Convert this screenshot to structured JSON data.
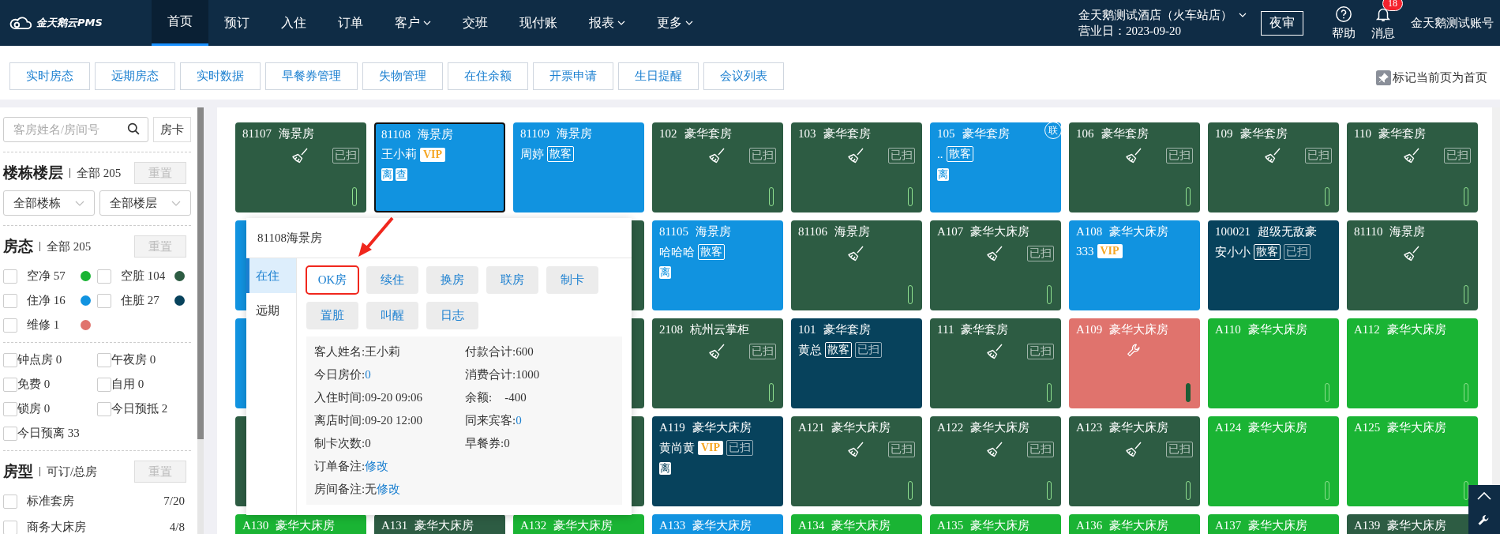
{
  "header": {
    "logo": "金天鹅云PMS",
    "nav": [
      {
        "label": "首页",
        "selected": true,
        "dropdown": false
      },
      {
        "label": "预订",
        "selected": false,
        "dropdown": false
      },
      {
        "label": "入住",
        "selected": false,
        "dropdown": false
      },
      {
        "label": "订单",
        "selected": false,
        "dropdown": false
      },
      {
        "label": "客户",
        "selected": false,
        "dropdown": true
      },
      {
        "label": "交班",
        "selected": false,
        "dropdown": false
      },
      {
        "label": "现付账",
        "selected": false,
        "dropdown": false
      },
      {
        "label": "报表",
        "selected": false,
        "dropdown": true
      },
      {
        "label": "更多",
        "selected": false,
        "dropdown": true
      }
    ],
    "hotel": "金天鹅测试酒店（火车站店）",
    "business_day": "营业日：2023-09-20",
    "night_audit": "夜审",
    "help": "帮助",
    "messages": {
      "label": "消息",
      "badge": "18"
    },
    "account": "金天鹅测试账号"
  },
  "tabs": [
    {
      "label": "实时房态",
      "selected": false
    },
    {
      "label": "远期房态",
      "selected": false
    },
    {
      "label": "实时数据",
      "selected": false
    },
    {
      "label": "早餐券管理",
      "selected": false
    },
    {
      "label": "失物管理",
      "selected": false
    },
    {
      "label": "在住余额",
      "selected": false
    },
    {
      "label": "开票申请",
      "selected": false
    },
    {
      "label": "生日提醒",
      "selected": false
    },
    {
      "label": "会议列表",
      "selected": false
    }
  ],
  "pin_home": "标记当前页为首页",
  "sidebar": {
    "search": {
      "placeholder": "客房姓名/房间号"
    },
    "card_button": "房卡",
    "building": {
      "title": "楼栋楼层",
      "summary": "全部 205",
      "reset": {
        "label": "重置",
        "disabled": true
      },
      "selects": [
        "全部楼栋",
        "全部楼层"
      ]
    },
    "status": {
      "title": "房态",
      "summary": "全部 205",
      "reset": {
        "label": "重置",
        "disabled": true
      },
      "filters": [
        {
          "label": "空净 57",
          "checked": false,
          "color": "#1ab434"
        },
        {
          "label": "空脏 104",
          "checked": false,
          "color": "#2d5c43"
        },
        {
          "label": "住净 16",
          "checked": false,
          "color": "#1193e0"
        },
        {
          "label": "住脏 27",
          "checked": false,
          "color": "#07425c"
        },
        {
          "label": "维修 1",
          "checked": false,
          "color": "#e0736d"
        }
      ]
    },
    "flags": [
      {
        "label": "钟点房 0",
        "checked": false
      },
      {
        "label": "午夜房 0",
        "checked": false
      },
      {
        "label": "免费 0",
        "checked": false
      },
      {
        "label": "自用 0",
        "checked": false
      },
      {
        "label": "锁房 0",
        "checked": false
      },
      {
        "label": "今日预抵 2",
        "checked": false
      },
      {
        "label": "今日预离 33",
        "checked": false
      }
    ],
    "room_types": {
      "title": "房型",
      "summary": "可订/总房",
      "reset": {
        "label": "重置",
        "disabled": true
      },
      "items": [
        {
          "label": "标准套房",
          "count": "7/20",
          "checked": false
        },
        {
          "label": "商务大床房",
          "count": "4/8",
          "checked": false
        }
      ]
    }
  },
  "grid": {
    "rows": [
      [
        {
          "kind": "vacant_dirty",
          "number": "81107",
          "type": "海景房",
          "selected": false,
          "tags": [
            {
              "kind": "swept",
              "text": "已扫"
            }
          ]
        },
        {
          "kind": "occupied_clean",
          "number": "81108",
          "type": "海景房",
          "selected": true,
          "guest": "王小莉",
          "tags": [
            {
              "kind": "vip",
              "text": "VIP"
            }
          ],
          "marks": [
            "离",
            "查"
          ]
        },
        {
          "kind": "occupied_clean",
          "number": "81109",
          "type": "海景房",
          "selected": false,
          "guest": "周婷",
          "tags": [
            {
              "kind": "walkin",
              "text": "散客"
            }
          ]
        },
        {
          "kind": "vacant_dirty",
          "number": "102",
          "type": "豪华套房",
          "selected": false,
          "tags": [
            {
              "kind": "swept",
              "text": "已扫"
            }
          ]
        },
        {
          "kind": "vacant_dirty",
          "number": "103",
          "type": "豪华套房",
          "selected": false,
          "tags": [
            {
              "kind": "swept",
              "text": "已扫"
            }
          ]
        },
        {
          "kind": "occupied_clean",
          "number": "105",
          "type": "豪华套房",
          "selected": false,
          "guest": "..",
          "tags": [
            {
              "kind": "walkin",
              "text": "散客"
            }
          ],
          "marks": [
            "离"
          ],
          "linked": "联"
        },
        {
          "kind": "vacant_dirty",
          "number": "106",
          "type": "豪华套房",
          "selected": false,
          "tags": [
            {
              "kind": "swept",
              "text": "已扫"
            }
          ]
        },
        {
          "kind": "vacant_dirty",
          "number": "109",
          "type": "豪华套房",
          "selected": false,
          "tags": [
            {
              "kind": "swept",
              "text": "已扫"
            }
          ]
        },
        {
          "kind": "vacant_dirty",
          "number": "110",
          "type": "豪华套房",
          "selected": false,
          "tags": [
            {
              "kind": "swept",
              "text": "已扫"
            }
          ]
        }
      ],
      [
        {
          "kind": "covered",
          "color": "#1193e0"
        },
        {
          "kind": "covered"
        },
        {
          "kind": "covered",
          "color": "#2d5c43"
        },
        {
          "kind": "occupied_clean",
          "number": "81105",
          "type": "海景房",
          "selected": false,
          "guest": "哈哈哈",
          "tags": [
            {
              "kind": "walkin",
              "text": "散客"
            }
          ],
          "marks": [
            "离"
          ]
        },
        {
          "kind": "vacant_dirty",
          "number": "81106",
          "type": "海景房",
          "selected": false
        },
        {
          "kind": "vacant_dirty",
          "number": "A107",
          "type": "豪华大床房",
          "selected": false,
          "tags": [
            {
              "kind": "swept",
              "text": "已扫"
            }
          ]
        },
        {
          "kind": "occupied_clean",
          "number": "A108",
          "type": "豪华大床房",
          "selected": false,
          "guest": "333",
          "tags": [
            {
              "kind": "vip",
              "text": "VIP"
            }
          ]
        },
        {
          "kind": "occupied_dirty",
          "number": "100021",
          "type": "超级无敌豪",
          "selected": false,
          "guest": "安小小",
          "tags": [
            {
              "kind": "walkin",
              "text": "散客"
            },
            {
              "kind": "swept",
              "text": "已扫"
            }
          ]
        },
        {
          "kind": "vacant_dirty",
          "number": "81110",
          "type": "海景房",
          "selected": false
        }
      ],
      [
        {
          "kind": "covered",
          "color": "#1193e0"
        },
        {
          "kind": "covered"
        },
        {
          "kind": "covered",
          "color": "#2d5c43"
        },
        {
          "kind": "vacant_dirty",
          "number": "2108",
          "type": "杭州云掌柜",
          "selected": false,
          "tags": [
            {
              "kind": "swept",
              "text": "已扫"
            }
          ]
        },
        {
          "kind": "occupied_dirty",
          "number": "101",
          "type": "豪华套房",
          "selected": false,
          "guest": "黄总",
          "tags": [
            {
              "kind": "walkin",
              "text": "散客"
            },
            {
              "kind": "swept",
              "text": "已扫"
            }
          ]
        },
        {
          "kind": "vacant_dirty",
          "number": "111",
          "type": "豪华套房",
          "selected": false,
          "tags": [
            {
              "kind": "swept",
              "text": "已扫"
            }
          ]
        },
        {
          "kind": "maintenance",
          "number": "A109",
          "type": "豪华大床房",
          "selected": false
        },
        {
          "kind": "vacant_clean",
          "number": "A110",
          "type": "豪华大床房",
          "selected": false
        },
        {
          "kind": "vacant_clean",
          "number": "A112",
          "type": "豪华大床房",
          "selected": false
        }
      ],
      [
        {
          "kind": "covered",
          "color": "#2d5c43"
        },
        {
          "kind": "covered"
        },
        {
          "kind": "covered",
          "color": "#2d5c43"
        },
        {
          "kind": "occupied_dirty",
          "number": "A119",
          "type": "豪华大床房",
          "selected": false,
          "guest": "黄尚黄",
          "tags": [
            {
              "kind": "vip",
              "text": "VIP"
            },
            {
              "kind": "swept",
              "text": "已扫"
            }
          ],
          "marks": [
            "离"
          ]
        },
        {
          "kind": "vacant_dirty",
          "number": "A121",
          "type": "豪华大床房",
          "selected": false,
          "tags": [
            {
              "kind": "swept",
              "text": "已扫"
            }
          ]
        },
        {
          "kind": "vacant_dirty",
          "number": "A122",
          "type": "豪华大床房",
          "selected": false,
          "tags": [
            {
              "kind": "swept",
              "text": "已扫"
            }
          ]
        },
        {
          "kind": "vacant_dirty",
          "number": "A123",
          "type": "豪华大床房",
          "selected": false,
          "tags": [
            {
              "kind": "swept",
              "text": "已扫"
            }
          ]
        },
        {
          "kind": "vacant_clean",
          "number": "A124",
          "type": "豪华大床房",
          "selected": false
        },
        {
          "kind": "vacant_clean",
          "number": "A125",
          "type": "豪华大床房",
          "selected": false
        }
      ],
      [
        {
          "kind": "vacant_clean",
          "number": "A130",
          "type": "豪华大床房",
          "selected": false
        },
        {
          "kind": "vacant_dirty",
          "number": "A131",
          "type": "豪华大床房",
          "selected": false
        },
        {
          "kind": "vacant_clean",
          "number": "A132",
          "type": "豪华大床房",
          "selected": false
        },
        {
          "kind": "occupied_clean",
          "number": "A133",
          "type": "豪华大床房",
          "selected": false
        },
        {
          "kind": "vacant_clean",
          "number": "A134",
          "type": "豪华大床房",
          "selected": false
        },
        {
          "kind": "vacant_clean",
          "number": "A135",
          "type": "豪华大床房",
          "selected": false
        },
        {
          "kind": "vacant_clean",
          "number": "A136",
          "type": "豪华大床房",
          "selected": false
        },
        {
          "kind": "vacant_clean",
          "number": "A137",
          "type": "豪华大床房",
          "selected": false
        },
        {
          "kind": "vacant_dirty",
          "number": "A139",
          "type": "豪华大床房",
          "selected": false
        }
      ]
    ]
  },
  "popup": {
    "title": "81108海景房",
    "tabs": [
      {
        "label": "在住",
        "selected": true
      },
      {
        "label": "远期",
        "selected": false
      }
    ],
    "actions": [
      {
        "label": "OK房",
        "highlighted": true
      },
      {
        "label": "续住",
        "highlighted": false
      },
      {
        "label": "换房",
        "highlighted": false
      },
      {
        "label": "联房",
        "highlighted": false
      },
      {
        "label": "制卡",
        "highlighted": false
      },
      {
        "label": "置脏",
        "highlighted": false
      },
      {
        "label": "叫醒",
        "highlighted": false
      },
      {
        "label": "日志",
        "highlighted": false
      }
    ],
    "info": [
      {
        "label": "客人姓名:",
        "value": "王小莉"
      },
      {
        "label": "付款合计:",
        "value": "600"
      },
      {
        "label": "今日房价:",
        "link": "0"
      },
      {
        "label": "消费合计:",
        "value": "1000"
      },
      {
        "label": "入住时间:",
        "value": "09-20 09:06"
      },
      {
        "label": "余额:",
        "value": "-400"
      },
      {
        "label": "离店时间:",
        "value": "09-20 12:00"
      },
      {
        "label": "同来宾客:",
        "link": "0"
      },
      {
        "label": "制卡次数:",
        "value": "0"
      },
      {
        "label": "早餐券:",
        "value": "0"
      }
    ],
    "notes": [
      {
        "label": "订单备注:",
        "link": "修改"
      },
      {
        "label": "房间备注:",
        "value": "无",
        "link": "修改"
      }
    ]
  }
}
